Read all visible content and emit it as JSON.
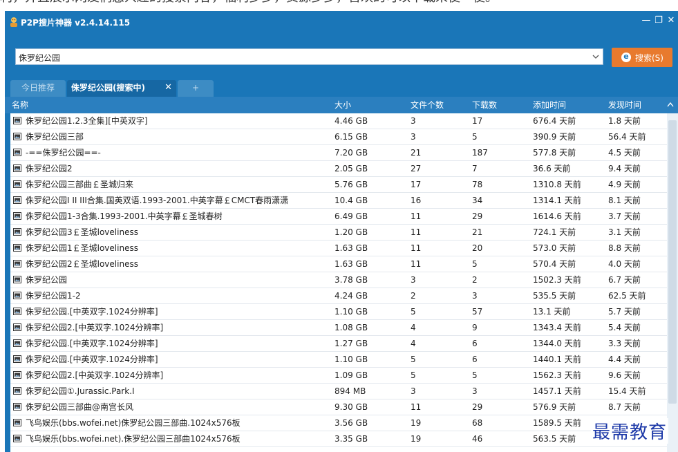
{
  "page_caption": "利，并且展示网友们感兴趣的搜索内容，福利多多，资源多多，喜欢的可以下载来使一使。",
  "app": {
    "title": "P2P搜片神器 v2.4.14.115",
    "minimize_label": "—",
    "restore_label": "❐",
    "close_label": "✕"
  },
  "search": {
    "value": "侏罗纪公园",
    "button_label": "搜索(S)",
    "button_icon": "ie-icon"
  },
  "tabs": {
    "today": "今日推荐",
    "active": "侏罗纪公园(搜索中)",
    "active_close": "✕",
    "add": "+"
  },
  "columns": {
    "name": "名称",
    "size": "大小",
    "file_count": "文件个数",
    "downloads": "下载数",
    "added": "添加时间",
    "found": "发现时间"
  },
  "rows": [
    {
      "name": "侏罗纪公园1.2.3全集][中英双字]",
      "size": "4.46 GB",
      "count": "3",
      "downloads": "17",
      "added": "676.4 天前",
      "found": "1.8 天前"
    },
    {
      "name": "侏罗纪公园三部",
      "size": "6.15 GB",
      "count": "3",
      "downloads": "5",
      "added": "390.9 天前",
      "found": "56.4 天前"
    },
    {
      "name": "-==侏罗纪公园==-",
      "size": "7.20 GB",
      "count": "21",
      "downloads": "187",
      "added": "577.8 天前",
      "found": "4.5 天前"
    },
    {
      "name": "侏罗纪公园2",
      "size": "2.05 GB",
      "count": "27",
      "downloads": "7",
      "added": "36.6 天前",
      "found": "9.4 天前"
    },
    {
      "name": "侏罗纪公园三部曲￡圣城归来",
      "size": "5.76 GB",
      "count": "17",
      "downloads": "78",
      "added": "1310.8 天前",
      "found": "4.9 天前"
    },
    {
      "name": "侏罗纪公园I II III合集.国英双语.1993-2001.中英字幕￡CMCT春雨潇潇",
      "size": "10.4 GB",
      "count": "16",
      "downloads": "34",
      "added": "1314.1 天前",
      "found": "8.1 天前"
    },
    {
      "name": "侏罗纪公园1-3合集.1993-2001.中英字幕￡圣城春树",
      "size": "6.49 GB",
      "count": "11",
      "downloads": "29",
      "added": "1614.6 天前",
      "found": "3.7 天前"
    },
    {
      "name": "侏罗纪公园3￡圣城loveliness",
      "size": "1.20 GB",
      "count": "11",
      "downloads": "21",
      "added": "724.1 天前",
      "found": "3.1 天前"
    },
    {
      "name": "侏罗纪公园1￡圣城loveliness",
      "size": "1.63 GB",
      "count": "11",
      "downloads": "20",
      "added": "573.0 天前",
      "found": "8.8 天前"
    },
    {
      "name": "侏罗纪公园2￡圣城loveliness",
      "size": "1.63 GB",
      "count": "11",
      "downloads": "5",
      "added": "570.4 天前",
      "found": "4.0 天前"
    },
    {
      "name": "侏罗纪公园",
      "size": "3.78 GB",
      "count": "3",
      "downloads": "2",
      "added": "1502.3 天前",
      "found": "6.7 天前"
    },
    {
      "name": "侏罗纪公园1-2",
      "size": "4.24 GB",
      "count": "2",
      "downloads": "3",
      "added": "535.5 天前",
      "found": "62.5 天前"
    },
    {
      "name": "侏罗纪公园.[中英双字.1024分辨率]",
      "size": "1.10 GB",
      "count": "5",
      "downloads": "57",
      "added": "13.1 天前",
      "found": "5.7 天前"
    },
    {
      "name": "侏罗纪公园2.[中英双字.1024分辨率]",
      "size": "1.08 GB",
      "count": "4",
      "downloads": "9",
      "added": "1343.4 天前",
      "found": "5.4 天前"
    },
    {
      "name": "侏罗纪公园.[中英双字.1024分辨率]",
      "size": "1.27 GB",
      "count": "4",
      "downloads": "6",
      "added": "1344.0 天前",
      "found": "3.3 天前"
    },
    {
      "name": "侏罗纪公园.[中英双字.1024分辨率]",
      "size": "1.10 GB",
      "count": "5",
      "downloads": "6",
      "added": "1440.1 天前",
      "found": "4.4 天前"
    },
    {
      "name": "侏罗纪公园2.[中英双字.1024分辨率]",
      "size": "1.09 GB",
      "count": "5",
      "downloads": "5",
      "added": "1562.3 天前",
      "found": "9.6 天前"
    },
    {
      "name": "侏罗纪公园①.Jurassic.Park.Ⅰ",
      "size": "894 MB",
      "count": "3",
      "downloads": "3",
      "added": "1457.1 天前",
      "found": "15.4 天前"
    },
    {
      "name": "侏罗纪公园三部曲@南宫长风",
      "size": "9.30 GB",
      "count": "11",
      "downloads": "29",
      "added": "576.9 天前",
      "found": "8.7 天前"
    },
    {
      "name": "飞鸟娱乐(bbs.wofei.net)侏罗纪公园三部曲.1024x576板",
      "size": "3.56 GB",
      "count": "19",
      "downloads": "68",
      "added": "1589.5 天前",
      "found": ""
    },
    {
      "name": "飞鸟娱乐(bbs.wofei.net).侏罗纪公园三部曲1024x576板",
      "size": "3.35 GB",
      "count": "19",
      "downloads": "46",
      "added": "563.5 天前",
      "found": ""
    }
  ],
  "row_icon": "film-file-icon",
  "watermark": "最需教育",
  "colors": {
    "chrome_blue": "#1a76b8",
    "header_blue": "#2b7fbf",
    "search_button_orange": "#e87a2e",
    "watermark_blue": "#1d39a8"
  }
}
